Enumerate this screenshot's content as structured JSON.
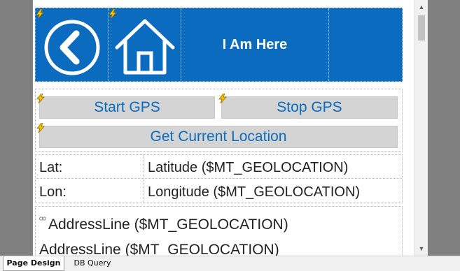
{
  "header": {
    "title": "I Am Here"
  },
  "buttons": {
    "start_gps": "Start GPS",
    "stop_gps": "Stop GPS",
    "get_location": "Get Current Location"
  },
  "coords": {
    "lat_label": "Lat:",
    "lat_value": "Latitude ($MT_GEOLOCATION)",
    "lon_label": "Lon:",
    "lon_value": "Longitude ($MT_GEOLOCATION)"
  },
  "address": {
    "line1": "AddressLine ($MT_GEOLOCATION)",
    "line2": "AddressLine ($MT_GEOLOCATION)"
  },
  "tabs": [
    "Page Design",
    "DB Query"
  ],
  "colors": {
    "accent": "#0b6cbf",
    "button_bg": "#d4d4d4",
    "margin": "#808080"
  },
  "icons": [
    "back-arrow-icon",
    "home-icon",
    "lightning-icon",
    "chain-link-icon"
  ]
}
